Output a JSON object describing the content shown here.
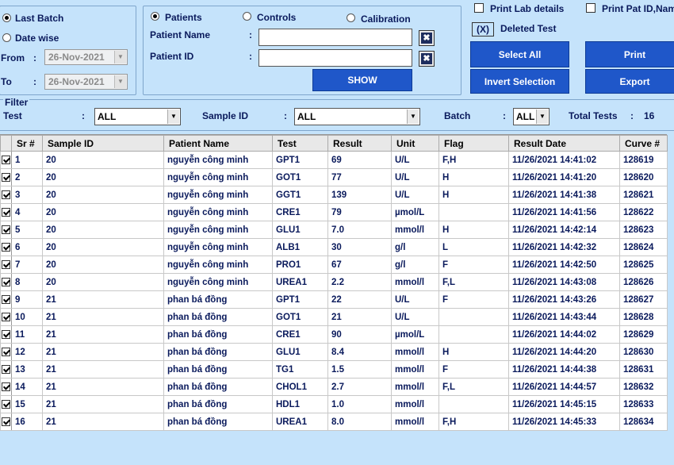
{
  "batch": {
    "last_batch_label": "Last Batch",
    "date_wise_label": "Date wise",
    "from_label": "From",
    "to_label": "To",
    "from_value": "26-Nov-2021",
    "to_value": "26-Nov-2021",
    "colon": ":"
  },
  "search": {
    "patients_label": "Patients",
    "controls_label": "Controls",
    "calibration_label": "Calibration",
    "patient_name_label": "Patient Name",
    "patient_id_label": "Patient ID",
    "patient_name_value": "",
    "patient_id_value": "",
    "show_label": "SHOW"
  },
  "options": {
    "print_lab_details_label": "Print Lab details",
    "print_pat_label": "Print Pat ID,Nam",
    "deleted_badge": "(X)",
    "deleted_test_label": "Deleted Test",
    "select_all_label": "Select All",
    "print_label": "Print",
    "invert_selection_label": "Invert Selection",
    "export_label": "Export"
  },
  "filter": {
    "title": "Filter",
    "test_label": "Test",
    "test_value": "ALL",
    "sample_id_label": "Sample ID",
    "sample_id_value": "ALL",
    "batch_label": "Batch",
    "batch_value": "ALL",
    "total_tests_label": "Total Tests",
    "total_tests_value": "16"
  },
  "table": {
    "headers": [
      "",
      "Sr #",
      "Sample ID",
      "Patient Name",
      "Test",
      "Result",
      "Unit",
      "Flag",
      "Result Date",
      "Curve #"
    ],
    "rows": [
      [
        "1",
        "20",
        "nguyễn công minh",
        "GPT1",
        "69",
        "U/L",
        "F,H",
        "11/26/2021 14:41:02",
        "128619"
      ],
      [
        "2",
        "20",
        "nguyễn công minh",
        "GOT1",
        "77",
        "U/L",
        "H",
        "11/26/2021 14:41:20",
        "128620"
      ],
      [
        "3",
        "20",
        "nguyễn công minh",
        "GGT1",
        "139",
        "U/L",
        "H",
        "11/26/2021 14:41:38",
        "128621"
      ],
      [
        "4",
        "20",
        "nguyễn công minh",
        "CRE1",
        "79",
        "µmol/L",
        "",
        "11/26/2021 14:41:56",
        "128622"
      ],
      [
        "5",
        "20",
        "nguyễn công minh",
        "GLU1",
        "7.0",
        "mmol/l",
        "H",
        "11/26/2021 14:42:14",
        "128623"
      ],
      [
        "6",
        "20",
        "nguyễn công minh",
        "ALB1",
        "30",
        "g/l",
        "L",
        "11/26/2021 14:42:32",
        "128624"
      ],
      [
        "7",
        "20",
        "nguyễn công minh",
        "PRO1",
        "67",
        "g/l",
        "F",
        "11/26/2021 14:42:50",
        "128625"
      ],
      [
        "8",
        "20",
        "nguyễn công minh",
        "UREA1",
        "2.2",
        "mmol/l",
        "F,L",
        "11/26/2021 14:43:08",
        "128626"
      ],
      [
        "9",
        "21",
        "phan bá đồng",
        "GPT1",
        "22",
        "U/L",
        "F",
        "11/26/2021 14:43:26",
        "128627"
      ],
      [
        "10",
        "21",
        "phan bá đồng",
        "GOT1",
        "21",
        "U/L",
        "",
        "11/26/2021 14:43:44",
        "128628"
      ],
      [
        "11",
        "21",
        "phan bá đồng",
        "CRE1",
        "90",
        "µmol/L",
        "",
        "11/26/2021 14:44:02",
        "128629"
      ],
      [
        "12",
        "21",
        "phan bá đồng",
        "GLU1",
        "8.4",
        "mmol/l",
        "H",
        "11/26/2021 14:44:20",
        "128630"
      ],
      [
        "13",
        "21",
        "phan bá đồng",
        "TG1",
        "1.5",
        "mmol/l",
        "F",
        "11/26/2021 14:44:38",
        "128631"
      ],
      [
        "14",
        "21",
        "phan bá đồng",
        "CHOL1",
        "2.7",
        "mmol/l",
        "F,L",
        "11/26/2021 14:44:57",
        "128632"
      ],
      [
        "15",
        "21",
        "phan bá đồng",
        "HDL1",
        "1.0",
        "mmol/l",
        "",
        "11/26/2021 14:45:15",
        "128633"
      ],
      [
        "16",
        "21",
        "phan bá đồng",
        "UREA1",
        "8.0",
        "mmol/l",
        "F,H",
        "11/26/2021 14:45:33",
        "128634"
      ]
    ]
  }
}
